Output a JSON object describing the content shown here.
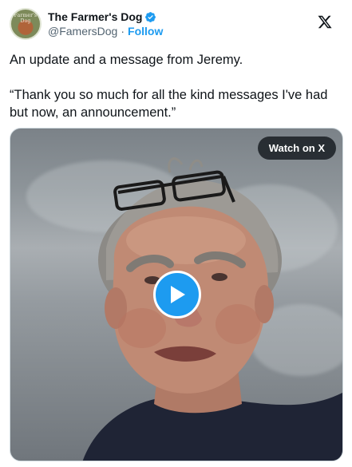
{
  "header": {
    "display_name": "The Farmer's Dog",
    "handle": "@FamersDog",
    "separator": "·",
    "follow_label": "Follow",
    "avatar_text": "Farmer's Dog"
  },
  "tweet": {
    "paragraphs": [
      "An update and a message from Jeremy.",
      "“Thank you so much for all the kind messages I've had but now, an announcement.”"
    ]
  },
  "media": {
    "watch_label": "Watch on X"
  },
  "icons": {
    "verified": "verified-badge-icon",
    "x_logo": "x-logo-icon",
    "play": "play-icon"
  },
  "colors": {
    "accent": "#1d9bf0",
    "text": "#0f1419",
    "secondary_text": "#536471",
    "watch_bg": "#0f1419"
  }
}
